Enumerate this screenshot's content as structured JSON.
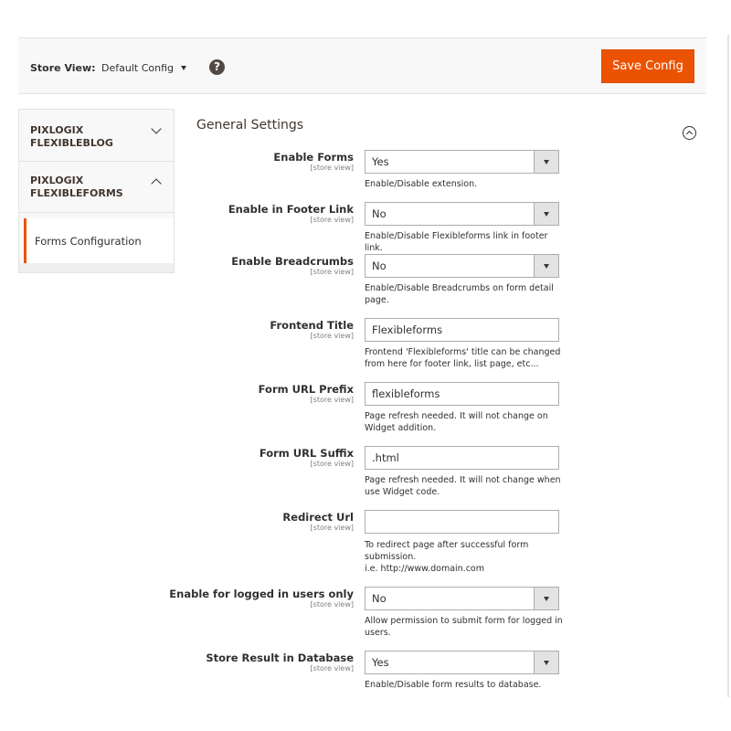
{
  "header": {
    "store_view_label": "Store View:",
    "store_view_value": "Default Config",
    "help_symbol": "?",
    "save_label": "Save Config"
  },
  "sidebar": {
    "groups": [
      {
        "line1": "PIXLOGIX",
        "line2": "FLEXIBLEBLOG",
        "state": "collapsed"
      },
      {
        "line1": "PIXLOGIX",
        "line2": "FLEXIBLEFORMS",
        "state": "expanded"
      }
    ],
    "active_item": "Forms Configuration"
  },
  "section": {
    "title": "General Settings"
  },
  "fields": [
    {
      "label": "Enable Forms",
      "scope": "[store view]",
      "type": "select",
      "value": "Yes",
      "note": [
        "Enable/Disable extension."
      ]
    },
    {
      "label": "Enable in Footer Link",
      "scope": "[store view]",
      "type": "select",
      "value": "No",
      "note": [
        "Enable/Disable Flexibleforms link in footer link."
      ]
    },
    {
      "label": "Enable Breadcrumbs",
      "scope": "[store view]",
      "type": "select",
      "value": "No",
      "note": [
        "Enable/Disable Breadcrumbs on form detail",
        "page."
      ]
    },
    {
      "label": "Frontend Title",
      "scope": "[store view]",
      "type": "text",
      "value": "Flexibleforms",
      "note": [
        "Frontend 'Flexibleforms' title can be changed",
        "from here for footer link, list page, etc..."
      ]
    },
    {
      "label": "Form URL Prefix",
      "scope": "[store view]",
      "type": "text",
      "value": "flexibleforms",
      "note": [
        "Page refresh needed. It will not change on",
        "Widget addition."
      ]
    },
    {
      "label": "Form URL Suffix",
      "scope": "[store view]",
      "type": "text",
      "value": ".html",
      "note": [
        "Page refresh needed. It will not change when",
        "use Widget code."
      ]
    },
    {
      "label": "Redirect Url",
      "scope": "[store view]",
      "type": "text",
      "value": "",
      "note": [
        "To redirect page after successful form",
        "submission.",
        "i.e. http://www.domain.com"
      ]
    },
    {
      "label": "Enable for logged in users only",
      "scope": "[store view]",
      "type": "select",
      "value": "No",
      "note": [
        "Allow permission to submit form for logged in",
        "users."
      ]
    },
    {
      "label": "Store Result in Database",
      "scope": "[store view]",
      "type": "select",
      "value": "Yes",
      "note": [
        "Enable/Disable form results to database."
      ]
    }
  ],
  "colors": {
    "accent": "#eb5202",
    "topbar_bg": "#f8f8f8",
    "dark": "#303030",
    "border": "#adadad"
  }
}
